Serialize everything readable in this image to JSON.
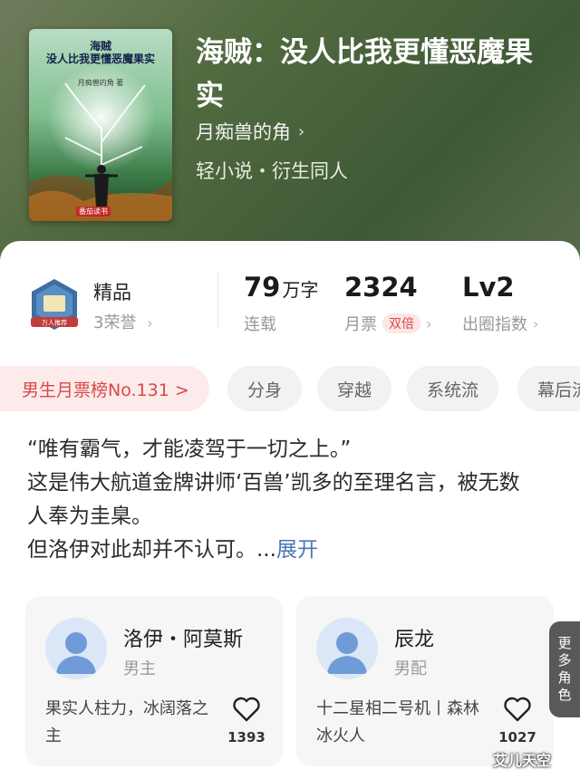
{
  "book": {
    "title": "海贼：没人比我更懂恶魔果实",
    "author": "月痴兽的角",
    "genre": "轻小说・衍生同人",
    "cover": {
      "title_line1": "海贼",
      "title_line2": "没人比我更懂恶魔果实",
      "author": "月痴兽的角 著",
      "publisher": "番茄读书"
    }
  },
  "stats": {
    "quality": {
      "title": "精品",
      "subtitle": "3荣誉",
      "badge_text": "万人推荐"
    },
    "words": {
      "value": "79",
      "unit": "万字",
      "label": "连载"
    },
    "tickets": {
      "value": "2324",
      "label": "月票",
      "badge": "双倍"
    },
    "level": {
      "value": "Lv2",
      "label": "出圈指数"
    }
  },
  "tags": [
    {
      "label": "男生月票榜No.131 >"
    },
    {
      "label": "分身"
    },
    {
      "label": "穿越"
    },
    {
      "label": "系统流"
    },
    {
      "label": "幕后流"
    }
  ],
  "description": {
    "line1": "“唯有霸气，才能凌驾于一切之上。”",
    "line2": "这是伟大航道金牌讲师‘百兽’凯多的至理名言，被无数人奉为圭臬。",
    "line3": "但洛伊对此却并不认可。...",
    "expand_label": "展开"
  },
  "characters": [
    {
      "name": "洛伊・阿莫斯",
      "role": "男主",
      "desc": "果实人柱力，冰阔落之主",
      "likes": "1393"
    },
    {
      "name": "辰龙",
      "role": "男配",
      "desc": "十二星相二号机丨森林冰火人",
      "likes": "1027"
    }
  ],
  "more_characters": [
    "更",
    "多",
    "角",
    "色"
  ],
  "watermark": "艾儿天空",
  "colors": {
    "accent_red": "#d84a4a",
    "link_blue": "#4a78b5",
    "header_green": "#4d653c"
  }
}
